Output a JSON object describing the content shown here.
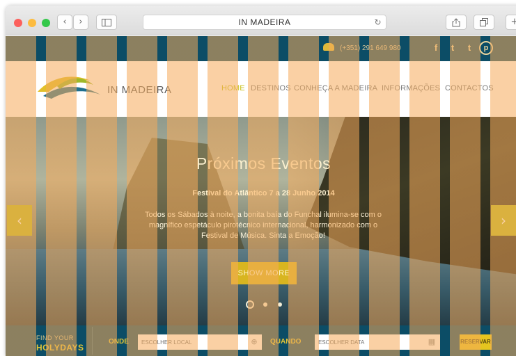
{
  "browser": {
    "url": "IN MADEIRA",
    "back_icon": "‹",
    "forward_icon": "›",
    "reload_icon": "↻",
    "plus_icon": "+"
  },
  "topbar": {
    "phone": "(+351) 291 649 980",
    "social": [
      "f",
      "t",
      "t",
      "p"
    ]
  },
  "header": {
    "brand": "IN MADEIRA",
    "nav": [
      "HOME",
      "DESTINOS",
      "CONHEÇA A MADEIRA",
      "INFORMAÇÕES",
      "CONTACTOS"
    ]
  },
  "hero": {
    "title": "Próximos Eventos",
    "event": "Festival do Atlântico 7 a 28 Junho 2014",
    "text": "Todos os Sábados à noite, a bonita baía do Funchal ilumina-se com o magnífico espetáculo pirotécnico internacional, harmonizado com o Festival de Música. Sinta a Emoção!",
    "button": "SHOW MORE",
    "prev_arrow": "‹",
    "next_arrow": "›"
  },
  "search": {
    "find_line1": "FIND YOUR",
    "find_line2": "HOLYDAYS",
    "onde_label": "ONDE",
    "onde_placeholder": "ESCOLHER LOCAL",
    "quando_label": "QUANDO",
    "quando_placeholder": "ESCOLHER DATA",
    "reservar": "RESERVAR"
  },
  "colors": {
    "brand_teal": "#0c4d66",
    "accent_yellow": "#e1c436"
  }
}
